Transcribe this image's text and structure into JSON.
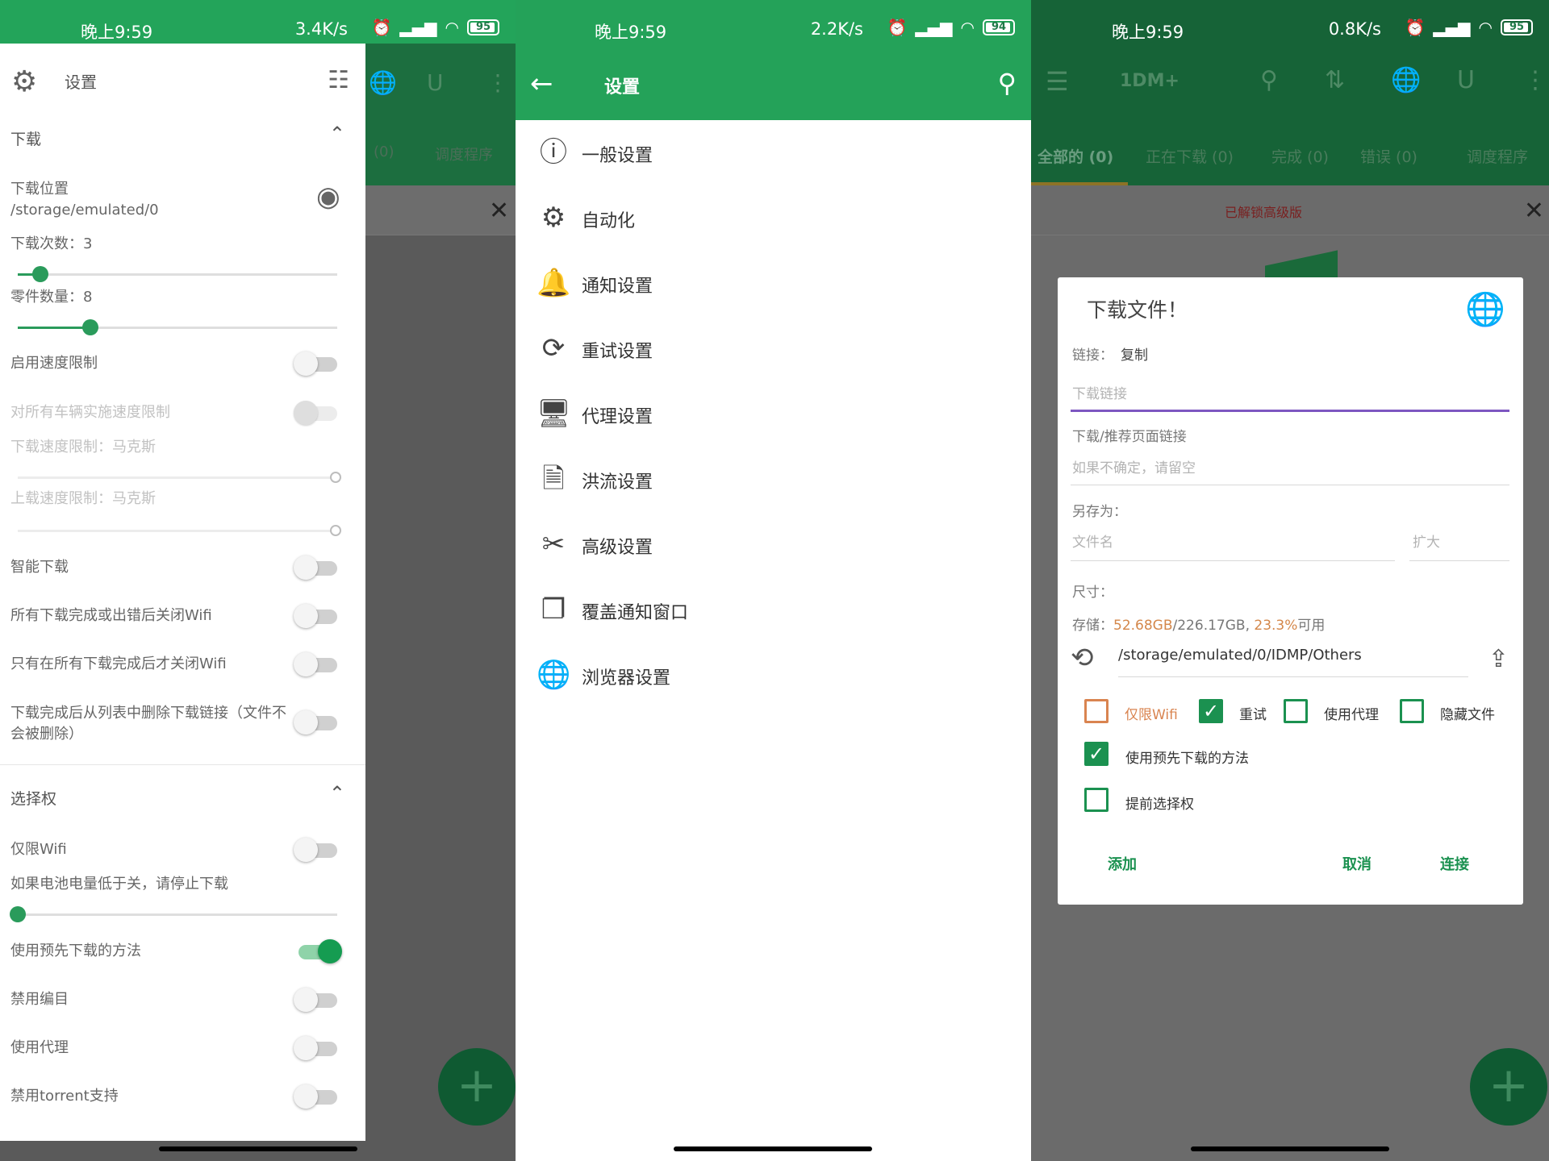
{
  "panel1": {
    "status": {
      "time": "晚上9:59",
      "speed": "3.4K/s",
      "battery": "95",
      "battery_level": 0.95
    },
    "background": {
      "tab_count": "(0)",
      "tab_scheduler": "调度程序"
    },
    "drawer": {
      "title": "设置",
      "section_download": "下载",
      "download_location_label": "下载位置",
      "download_location_path": "/storage/emulated/0",
      "download_times_label": "下载次数：3",
      "download_times_value": 3,
      "parts_label": "零件数量：8",
      "parts_value": 8,
      "speed_limit": "启用速度限制",
      "speed_limit_all": "对所有车辆实施速度限制",
      "download_speed_limit": "下载速度限制：马克斯",
      "upload_speed_limit": "上载速度限制：马克斯",
      "smart_download": "智能下载",
      "close_wifi_done_or_error": "所有下载完成或出错后关闭Wifi",
      "close_wifi_all_done": "只有在所有下载完成后才关闭Wifi",
      "remove_link_after_done": "下载完成后从列表中删除下载链接（文件不会被删除）",
      "section_options": "选择权",
      "wifi_only": "仅限Wifi",
      "battery_stop": "如果电池电量低于关，请停止下载",
      "use_predownload": "使用预先下载的方法",
      "disable_catalog": "禁用编目",
      "use_proxy": "使用代理",
      "disable_torrent": "禁用torrent支持"
    }
  },
  "panel2": {
    "status": {
      "time": "晚上9:59",
      "speed": "2.2K/s",
      "battery": "94",
      "battery_level": 0.94
    },
    "title": "设置",
    "items": [
      {
        "label": "一般设置",
        "icon": "info-icon"
      },
      {
        "label": "自动化",
        "icon": "automation-gear-icon"
      },
      {
        "label": "通知设置",
        "icon": "bell-icon"
      },
      {
        "label": "重试设置",
        "icon": "retry-icon"
      },
      {
        "label": "代理设置",
        "icon": "proxy-monitor-icon"
      },
      {
        "label": "洪流设置",
        "icon": "torrent-file-icon"
      },
      {
        "label": "高级设置",
        "icon": "tools-icon"
      },
      {
        "label": "覆盖通知窗口",
        "icon": "overlay-windows-icon"
      },
      {
        "label": "浏览器设置",
        "icon": "globe-icon"
      }
    ]
  },
  "panel3": {
    "status": {
      "time": "晚上9:59",
      "speed": "0.8K/s",
      "battery": "95",
      "battery_level": 0.95
    },
    "app_title": "1DM+",
    "tabs": [
      "全部的 (0)",
      "正在下载 (0)",
      "完成 (0)",
      "错误 (0)",
      "调度程序"
    ],
    "unlocked": "已解锁高级版",
    "dialog": {
      "title": "下载文件！",
      "link_label": "链接：",
      "copy": "复制",
      "link_placeholder": "下载链接",
      "referer_label": "下载/推荐页面链接",
      "referer_placeholder": "如果不确定，请留空",
      "save_as_label": "另存为：",
      "filename_placeholder": "文件名",
      "extension_placeholder": "扩大",
      "size_label": "尺寸：",
      "storage_prefix": "存储：",
      "storage_used": "52.68GB",
      "storage_total": "/226.17GB, ",
      "storage_percent": "23.3%",
      "storage_suffix": "可用",
      "path": "/storage/emulated/0/IDMP/Others",
      "cb_wifi_only": "仅限Wifi",
      "cb_retry": "重试",
      "cb_use_proxy": "使用代理",
      "cb_hide_file": "隐藏文件",
      "cb_predownload": "使用预先下载的方法",
      "cb_advance_options": "提前选择权",
      "btn_add": "添加",
      "btn_cancel": "取消",
      "btn_connect": "连接"
    }
  },
  "colors": {
    "primary_green": "#24a259",
    "dark_green": "#166337",
    "accent_orange": "#d98450",
    "focus_purple": "#7d57c1"
  }
}
